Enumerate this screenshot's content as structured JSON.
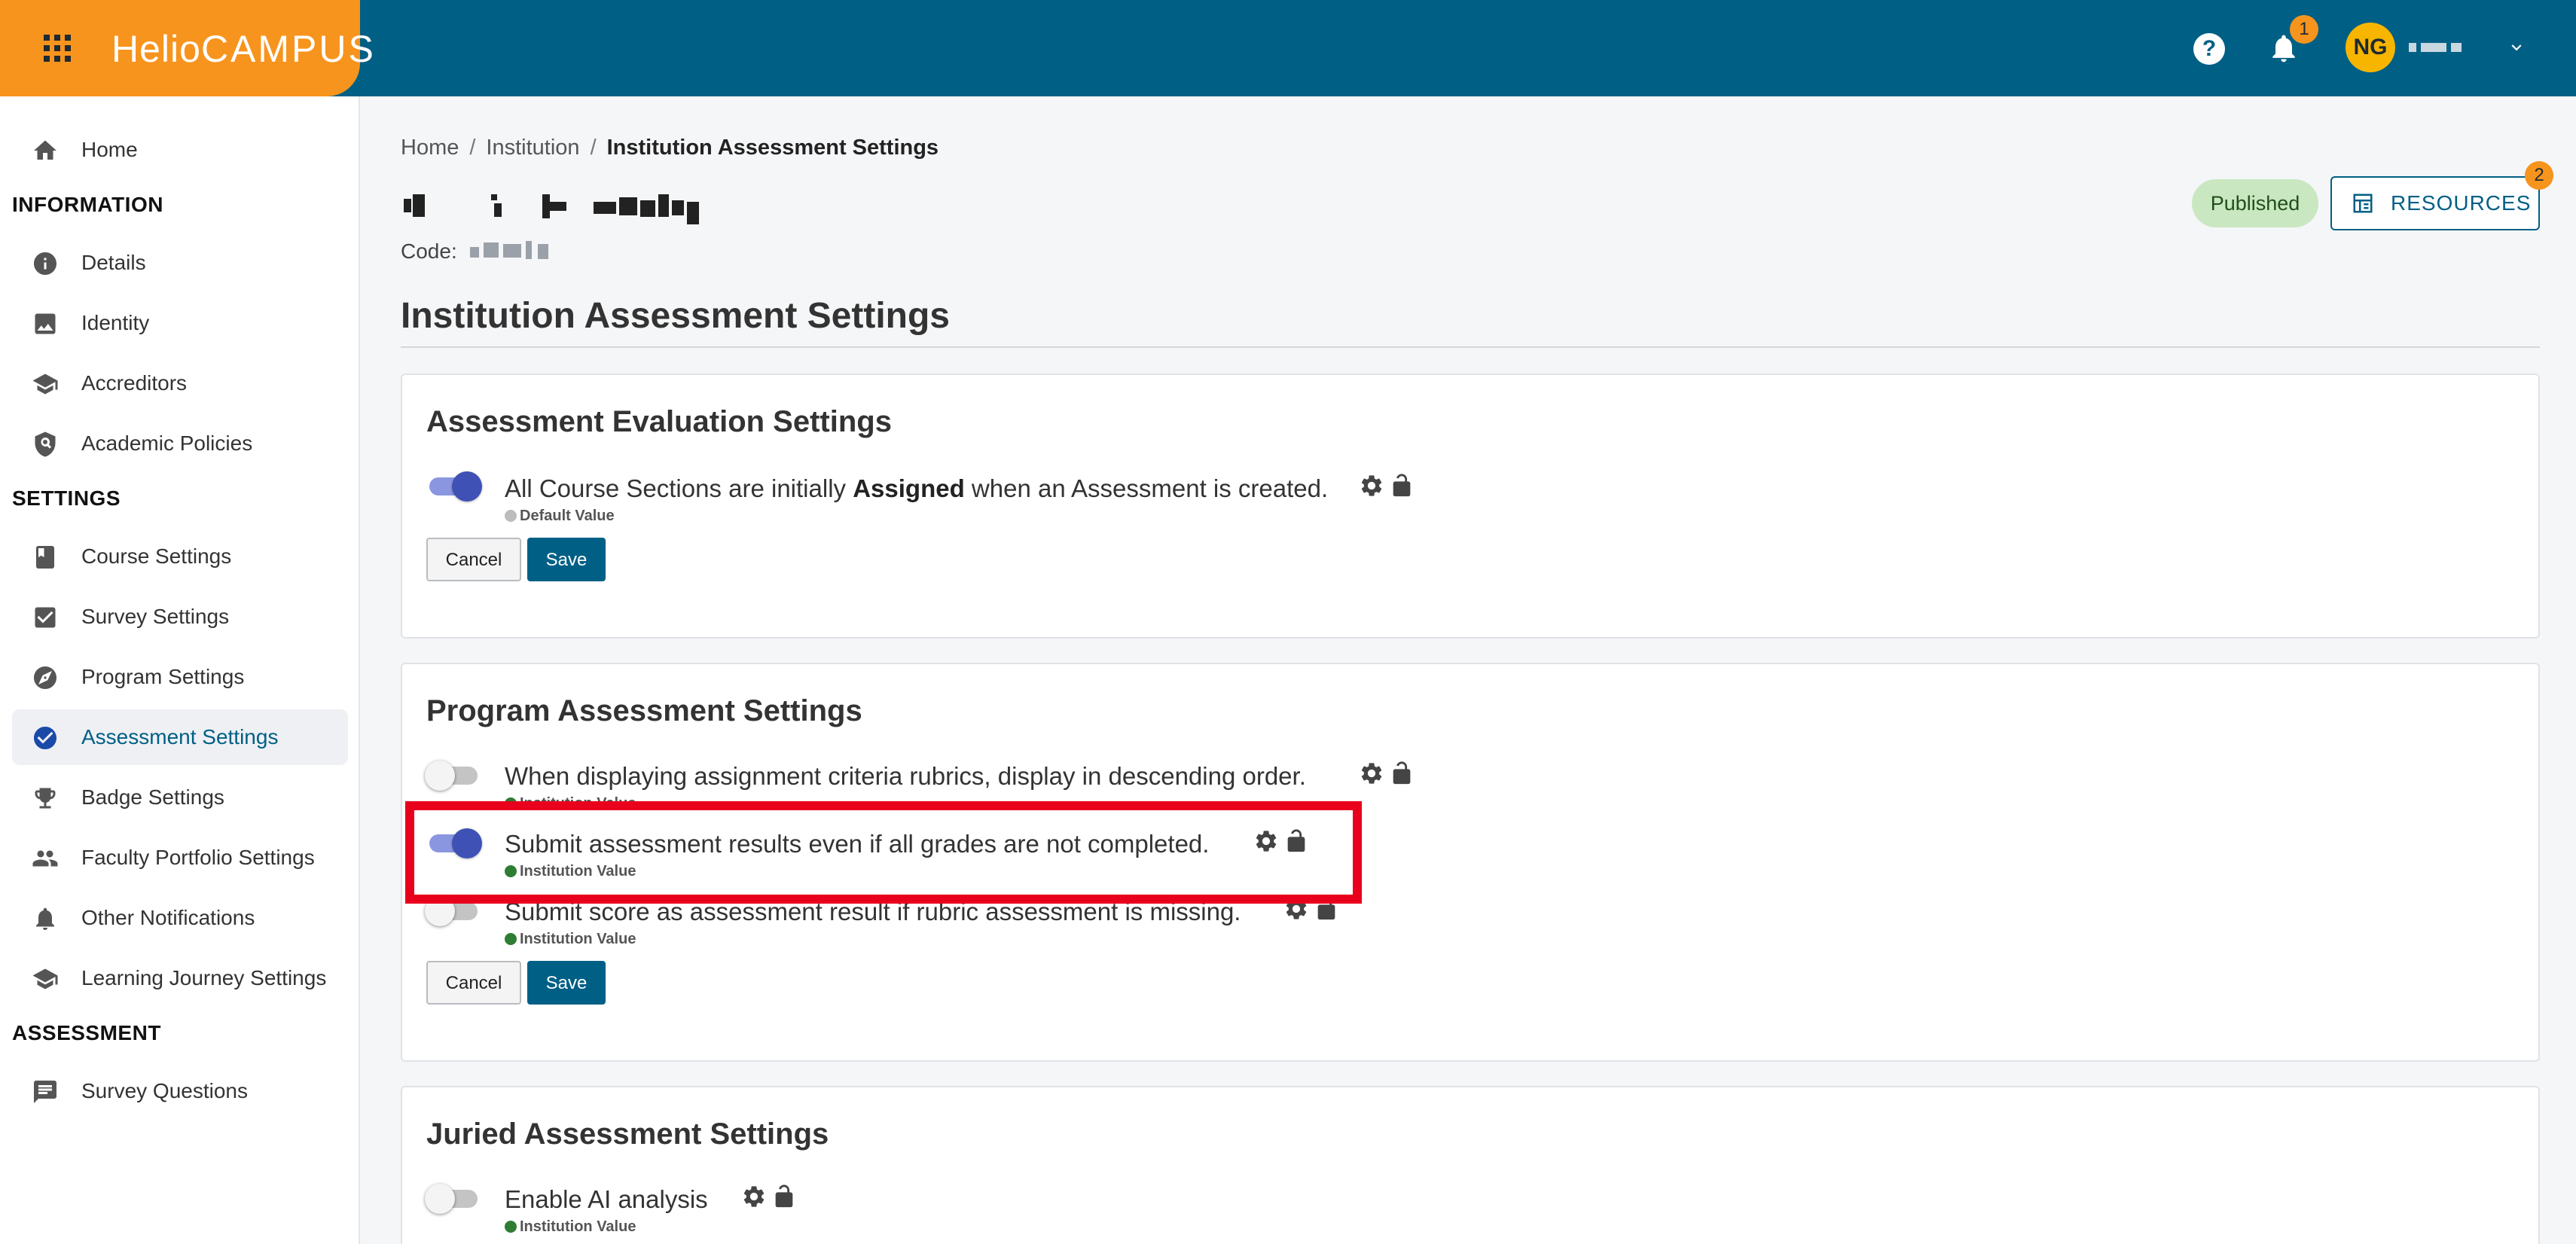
{
  "header": {
    "brand_bold": "Helio",
    "brand_light": "CAMPUS",
    "help_glyph": "?",
    "notification_count": "1",
    "user_initials": "NG"
  },
  "sidebar": {
    "sections": {
      "information": "INFORMATION",
      "settings": "SETTINGS",
      "assessment": "ASSESSMENT"
    },
    "items": [
      {
        "label": "Home",
        "icon": "home-icon"
      },
      {
        "label": "Details",
        "icon": "info-icon"
      },
      {
        "label": "Identity",
        "icon": "image-icon"
      },
      {
        "label": "Accreditors",
        "icon": "school-icon"
      },
      {
        "label": "Academic Policies",
        "icon": "policy-icon"
      },
      {
        "label": "Course Settings",
        "icon": "book-icon"
      },
      {
        "label": "Survey Settings",
        "icon": "checkbox-icon"
      },
      {
        "label": "Program Settings",
        "icon": "compass-icon"
      },
      {
        "label": "Assessment Settings",
        "icon": "check-circle-icon",
        "active": true
      },
      {
        "label": "Badge Settings",
        "icon": "trophy-icon"
      },
      {
        "label": "Faculty Portfolio Settings",
        "icon": "people-icon"
      },
      {
        "label": "Other Notifications",
        "icon": "bell-icon"
      },
      {
        "label": "Learning Journey Settings",
        "icon": "school-icon"
      },
      {
        "label": "Survey Questions",
        "icon": "chat-icon"
      }
    ]
  },
  "breadcrumb": {
    "items": [
      "Home",
      "Institution"
    ],
    "separator": "/",
    "current": "Institution Assessment Settings"
  },
  "institution": {
    "code_label": "Code:"
  },
  "status": {
    "published": "Published",
    "resources_label": "RESOURCES",
    "resources_count": "2"
  },
  "page": {
    "title": "Institution Assessment Settings"
  },
  "cards": [
    {
      "title": "Assessment Evaluation Settings",
      "settings": [
        {
          "text_before": "All Course Sections are initially ",
          "text_bold": "Assigned",
          "text_after": " when an Assessment is created.",
          "on": true,
          "value_label": "Default Value",
          "value_color": "#bdbdbd"
        }
      ],
      "cancel": "Cancel",
      "save": "Save"
    },
    {
      "title": "Program Assessment Settings",
      "settings": [
        {
          "text": "When displaying assignment criteria rubrics, display in descending order.",
          "on": false,
          "value_label": "Institution Value",
          "value_color": "#2e7d32"
        },
        {
          "text": "Submit assessment results even if all grades are not completed.",
          "on": true,
          "value_label": "Institution Value",
          "value_color": "#2e7d32"
        },
        {
          "text": "Submit score as assessment result if rubric assessment is missing.",
          "on": false,
          "value_label": "Institution Value",
          "value_color": "#2e7d32"
        }
      ],
      "cancel": "Cancel",
      "save": "Save"
    },
    {
      "title": "Juried Assessment Settings",
      "settings": [
        {
          "text": "Enable AI analysis",
          "on": false,
          "value_label": "Institution Value",
          "value_color": "#2e7d32"
        }
      ]
    }
  ],
  "colors": {
    "topbar": "#005f85",
    "brand": "#f7941d",
    "toggle_on": "#3f51b5",
    "highlight": "#e8001c"
  }
}
